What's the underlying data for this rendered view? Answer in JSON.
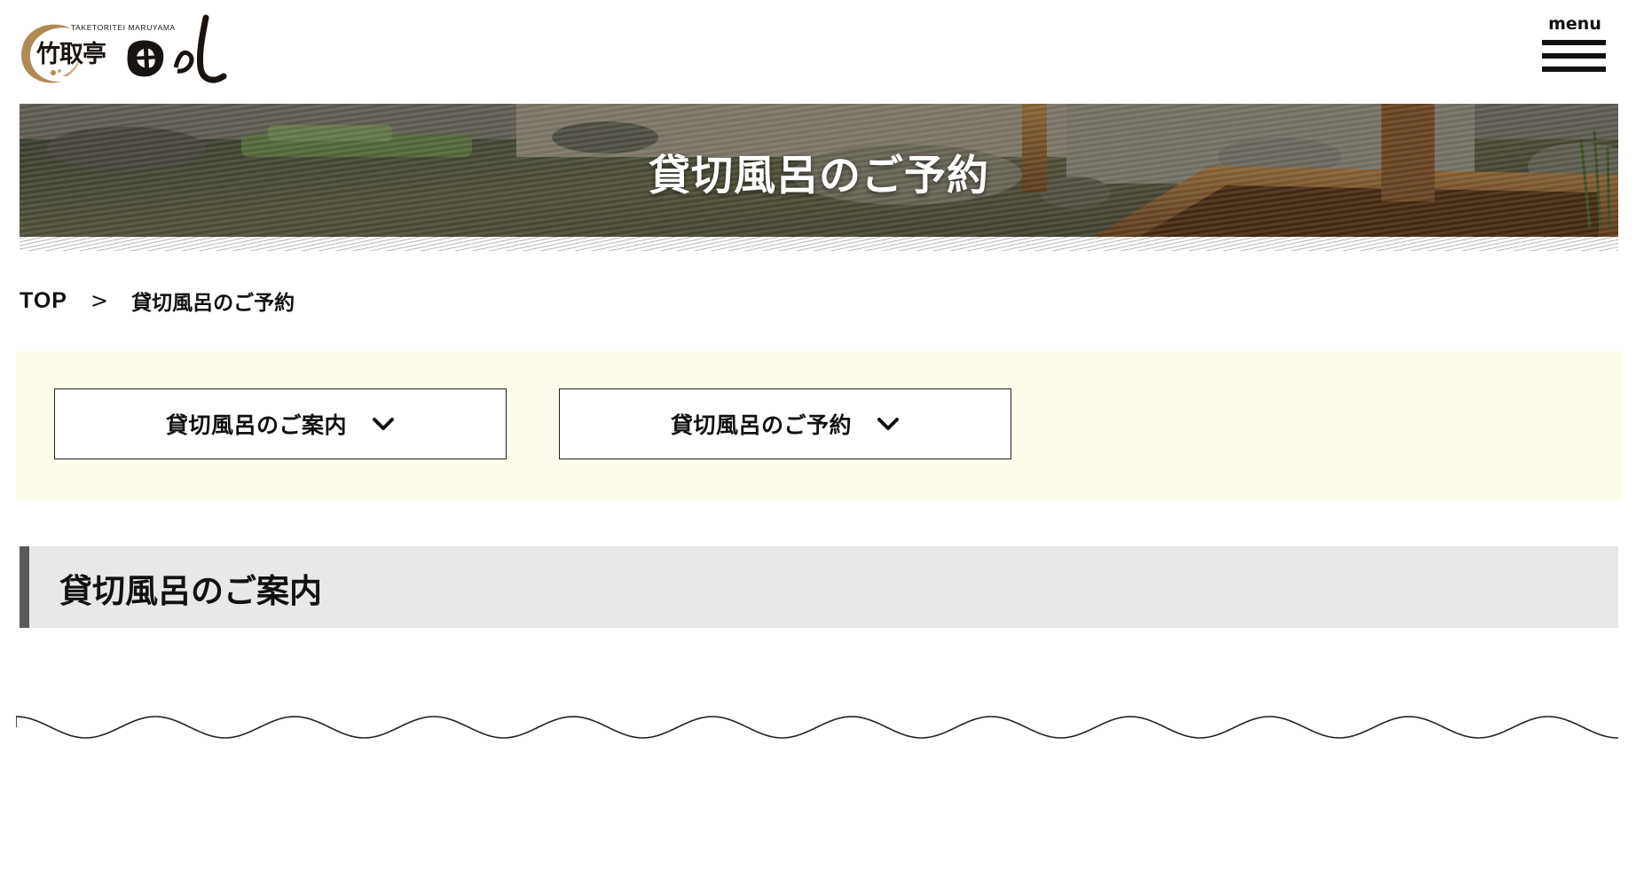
{
  "header": {
    "logo": {
      "romanized": "TAKETORITEI MARUYAMA",
      "kanji": "竹取亭"
    },
    "menu_label": "menu"
  },
  "hero": {
    "title": "貸切風呂のご予約"
  },
  "breadcrumb": {
    "home": "TOP",
    "separator": ">",
    "current": "貸切風呂のご予約"
  },
  "anchor_nav": {
    "buttons": [
      {
        "label": "貸切風呂のご案内",
        "icon": "chevron-down-icon"
      },
      {
        "label": "貸切風呂のご予約",
        "icon": "chevron-down-icon"
      }
    ]
  },
  "section": {
    "heading": "貸切風呂のご案内"
  },
  "colors": {
    "anchor_nav_bg": "#fdfbea",
    "section_head_bg": "#e8e8e8",
    "section_head_bar": "#5a5a5a",
    "logo_accent": "#b08a55"
  }
}
